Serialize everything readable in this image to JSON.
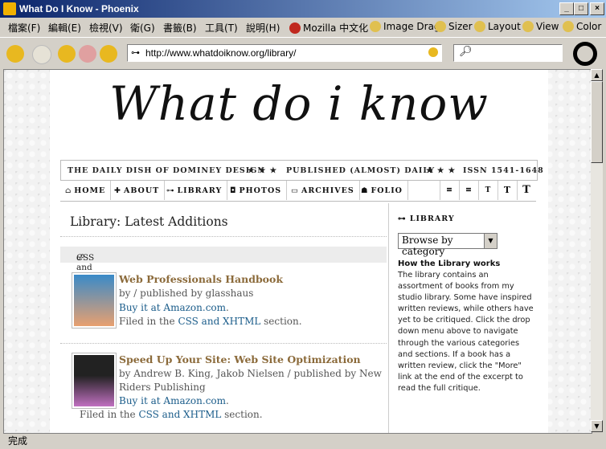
{
  "window": {
    "title": "What Do I Know - Phoenix"
  },
  "menu": [
    "檔案(F)",
    "編輯(E)",
    "檢視(V)",
    "衛(G)",
    "書籤(B)",
    "工具(T)",
    "說明(H)"
  ],
  "extensions": [
    "Mozilla 中文化",
    "Image Drag",
    "Sizer",
    "Layout",
    "View",
    "Color"
  ],
  "address": {
    "url": "http://www.whatdoiknow.org/library/"
  },
  "site": {
    "logo": "What do i know",
    "strap": {
      "tagline": "THE DAILY DISH OF DOMINEY DESIGN",
      "stars": "★ ★ ★",
      "published": "PUBLISHED (ALMOST) DAILY",
      "issn": "ISSN 1541-1648"
    },
    "nav": [
      {
        "glyph": "⌂",
        "label": "HOME"
      },
      {
        "glyph": "✚",
        "label": "ABOUT"
      },
      {
        "glyph": "⊶",
        "label": "LIBRARY"
      },
      {
        "glyph": "◘",
        "label": "PHOTOS"
      },
      {
        "glyph": "▭",
        "label": "ARCHIVES"
      },
      {
        "glyph": "☗",
        "label": "FOLIO"
      }
    ],
    "tools": [
      "≡",
      "≡",
      "T",
      "T",
      "T"
    ]
  },
  "main": {
    "heading": "Library: Latest Additions",
    "section": "CSS and XHTML",
    "books": [
      {
        "title": "Web Professionals Handbook",
        "by": "by / published by glasshaus",
        "buy": "Buy it at Amazon.com",
        "filed_pre": "Filed in the ",
        "filed_link": "CSS and XHTML",
        "filed_post": " section."
      },
      {
        "title": "Speed Up Your Site: Web Site Optimization",
        "by1": "by Andrew B. King, Jakob Nielsen / published by New",
        "by2": "Riders Publishing",
        "buy": "Buy it at Amazon.com",
        "filed_pre": "Filed in the ",
        "filed_link": "CSS and XHTML",
        "filed_post": " section."
      }
    ]
  },
  "sidebar": {
    "heading": "LIBRARY",
    "select": "Browse by category",
    "how_title": "How the Library works",
    "how_text": "The library contains an assortment of books from my studio library. Some have inspired written reviews, while others have yet to be critiqued. Click the drop down menu above to navigate through the various categories and sections. If a book has a written review, click the \"More\" link at the end of the excerpt to read the full critique."
  },
  "status": "完成"
}
